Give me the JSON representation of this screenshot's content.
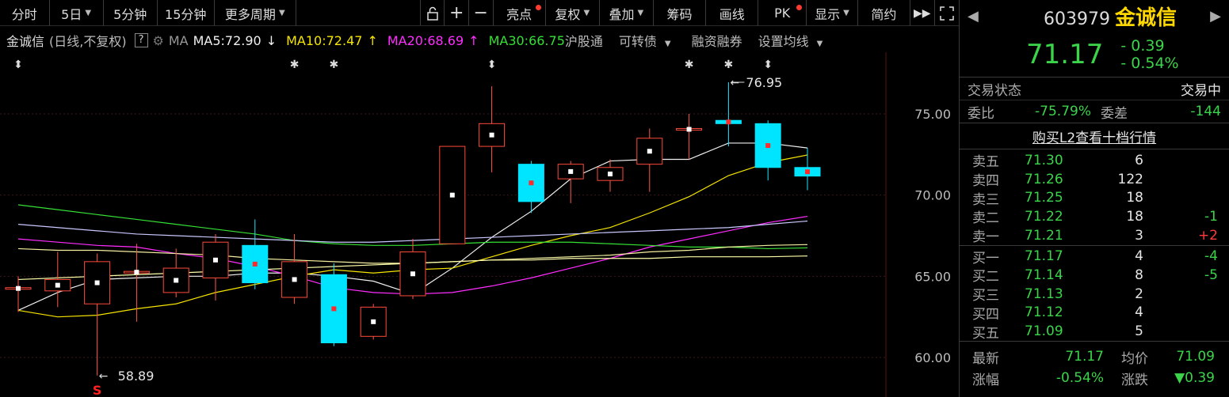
{
  "toolbar": {
    "left": [
      "分时",
      "5日",
      "5分钟",
      "15分钟",
      "更多周期"
    ],
    "right": [
      "亮点",
      "复权",
      "叠加",
      "筹码",
      "画线",
      "PK",
      "显示",
      "简约"
    ]
  },
  "legend": {
    "name": "金诚信",
    "sub": "(日线,不复权)",
    "help": "?",
    "ma": "MA",
    "ma5": "MA5:72.90",
    "ma5_arrow": "↓",
    "ma10": "MA10:72.47",
    "ma10_arrow": "↑",
    "ma20": "MA20:68.69",
    "ma20_arrow": "↑",
    "ma30": "MA30:66.75",
    "links": [
      "沪股通",
      "可转债",
      "融资融券",
      "设置均线"
    ]
  },
  "chart_data": {
    "type": "candlestick",
    "ylim": [
      58.0,
      79.0
    ],
    "yticks": [
      "75.00",
      "70.00",
      "65.00",
      "60.00"
    ],
    "candles": [
      {
        "o": 64.3,
        "c": 64.3,
        "h": 65.0,
        "l": 62.8
      },
      {
        "o": 64.1,
        "c": 64.8,
        "h": 66.5,
        "l": 63.1
      },
      {
        "o": 63.3,
        "c": 65.9,
        "h": 66.4,
        "l": 58.89
      },
      {
        "o": 65.3,
        "c": 65.3,
        "h": 67.0,
        "l": 62.2
      },
      {
        "o": 64.0,
        "c": 65.5,
        "h": 66.7,
        "l": 63.7
      },
      {
        "o": 64.9,
        "c": 67.1,
        "h": 67.6,
        "l": 63.5
      },
      {
        "o": 66.9,
        "c": 64.6,
        "h": 68.5,
        "l": 64.2
      },
      {
        "o": 63.7,
        "c": 65.9,
        "h": 67.6,
        "l": 63.3
      },
      {
        "o": 65.1,
        "c": 60.9,
        "h": 65.8,
        "l": 60.7
      },
      {
        "o": 61.3,
        "c": 63.1,
        "h": 63.3,
        "l": 61.1
      },
      {
        "o": 63.8,
        "c": 66.5,
        "h": 67.3,
        "l": 63.6
      },
      {
        "o": 67.0,
        "c": 73.0,
        "h": 73.0,
        "l": 67.0
      },
      {
        "o": 73.0,
        "c": 74.4,
        "h": 76.7,
        "l": 71.4
      },
      {
        "o": 71.9,
        "c": 69.6,
        "h": 72.1,
        "l": 68.9
      },
      {
        "o": 71.0,
        "c": 71.9,
        "h": 72.1,
        "l": 69.5
      },
      {
        "o": 70.9,
        "c": 71.7,
        "h": 72.2,
        "l": 70.2
      },
      {
        "o": 71.9,
        "c": 73.5,
        "h": 74.1,
        "l": 70.2
      },
      {
        "o": 74.0,
        "c": 74.1,
        "h": 75.0,
        "l": 72.2
      },
      {
        "o": 74.6,
        "c": 74.4,
        "h": 76.95,
        "l": 73.0
      },
      {
        "o": 74.4,
        "c": 71.7,
        "h": 74.6,
        "l": 70.9
      },
      {
        "o": 71.7,
        "c": 71.17,
        "h": 72.9,
        "l": 70.3
      }
    ],
    "series": [
      {
        "name": "MA5",
        "color": "#f0f0f0",
        "values": [
          62.9,
          64.0,
          64.8,
          64.9,
          65.0,
          65.0,
          65.2,
          65.2,
          65.0,
          64.7,
          63.9,
          65.5,
          67.4,
          69.0,
          71.0,
          72.1,
          72.2,
          72.2,
          73.2,
          73.2,
          72.9
        ]
      },
      {
        "name": "MA10",
        "color": "#f5e400",
        "values": [
          62.9,
          62.5,
          62.6,
          63.0,
          63.3,
          64.0,
          64.5,
          65.0,
          65.4,
          65.2,
          65.4,
          65.5,
          66.2,
          66.9,
          67.5,
          68.0,
          68.9,
          69.9,
          71.2,
          72.0,
          72.47
        ]
      },
      {
        "name": "MA20",
        "color": "#ff2dff",
        "values": [
          67.3,
          67.1,
          66.9,
          66.8,
          66.4,
          66.1,
          65.6,
          65.0,
          64.3,
          64.0,
          63.9,
          64.0,
          64.4,
          64.9,
          65.5,
          66.1,
          66.8,
          67.3,
          67.8,
          68.3,
          68.69
        ]
      },
      {
        "name": "MA30",
        "color": "#35e035",
        "values": [
          69.4,
          69.1,
          68.8,
          68.5,
          68.2,
          67.9,
          67.6,
          67.2,
          67.0,
          66.9,
          66.9,
          67.0,
          67.1,
          67.1,
          67.1,
          67.0,
          66.9,
          66.8,
          66.8,
          66.7,
          66.75
        ]
      },
      {
        "color": "#c8c8ff",
        "values": [
          68.2,
          68.0,
          67.8,
          67.6,
          67.5,
          67.4,
          67.3,
          67.2,
          67.1,
          67.1,
          67.2,
          67.3,
          67.4,
          67.5,
          67.6,
          67.7,
          67.8,
          67.9,
          68.0,
          68.2,
          68.4
        ]
      },
      {
        "color": "#f5f0a0",
        "values": [
          66.7,
          66.6,
          66.6,
          66.5,
          66.4,
          66.3,
          66.1,
          66.0,
          65.9,
          65.8,
          65.8,
          65.9,
          66.0,
          66.1,
          66.2,
          66.3,
          66.5,
          66.6,
          66.8,
          66.9,
          66.95
        ]
      },
      {
        "color": "#ffffaa",
        "values": [
          64.8,
          64.9,
          65.0,
          65.1,
          65.2,
          65.3,
          65.4,
          65.5,
          65.6,
          65.7,
          65.8,
          65.9,
          66.0,
          66.0,
          66.1,
          66.1,
          66.1,
          66.2,
          66.2,
          66.2,
          66.25
        ]
      }
    ],
    "annotations": {
      "high_label": "76.95",
      "low_label": "58.89",
      "marker_s": "S"
    }
  },
  "quote": {
    "code": "603979",
    "name": "金诚信",
    "price": "71.17",
    "change": "- 0.39",
    "change_pct": "- 0.54%",
    "status_label": "交易状态",
    "status_value": "交易中",
    "ratio_label": "委比",
    "ratio_value": "-75.79%",
    "diff_label": "委差",
    "diff_value": "-144",
    "l2_link": "购买L2查看十档行情",
    "asks": [
      {
        "label": "卖五",
        "price": "71.30",
        "vol": "6",
        "delta": ""
      },
      {
        "label": "卖四",
        "price": "71.26",
        "vol": "122",
        "delta": ""
      },
      {
        "label": "卖三",
        "price": "71.25",
        "vol": "18",
        "delta": ""
      },
      {
        "label": "卖二",
        "price": "71.22",
        "vol": "18",
        "delta": "-1"
      },
      {
        "label": "卖一",
        "price": "71.21",
        "vol": "3",
        "delta": "+2"
      }
    ],
    "bids": [
      {
        "label": "买一",
        "price": "71.17",
        "vol": "4",
        "delta": "-4"
      },
      {
        "label": "买二",
        "price": "71.14",
        "vol": "8",
        "delta": "-5"
      },
      {
        "label": "买三",
        "price": "71.13",
        "vol": "2",
        "delta": ""
      },
      {
        "label": "买四",
        "price": "71.12",
        "vol": "4",
        "delta": ""
      },
      {
        "label": "买五",
        "price": "71.09",
        "vol": "5",
        "delta": ""
      }
    ],
    "latest_label": "最新",
    "latest_value": "71.17",
    "avg_label": "均价",
    "avg_value": "71.09",
    "pct_label": "涨幅",
    "pct_value": "-0.54%",
    "chg_label": "涨跌",
    "chg_value": "▼0.39"
  }
}
